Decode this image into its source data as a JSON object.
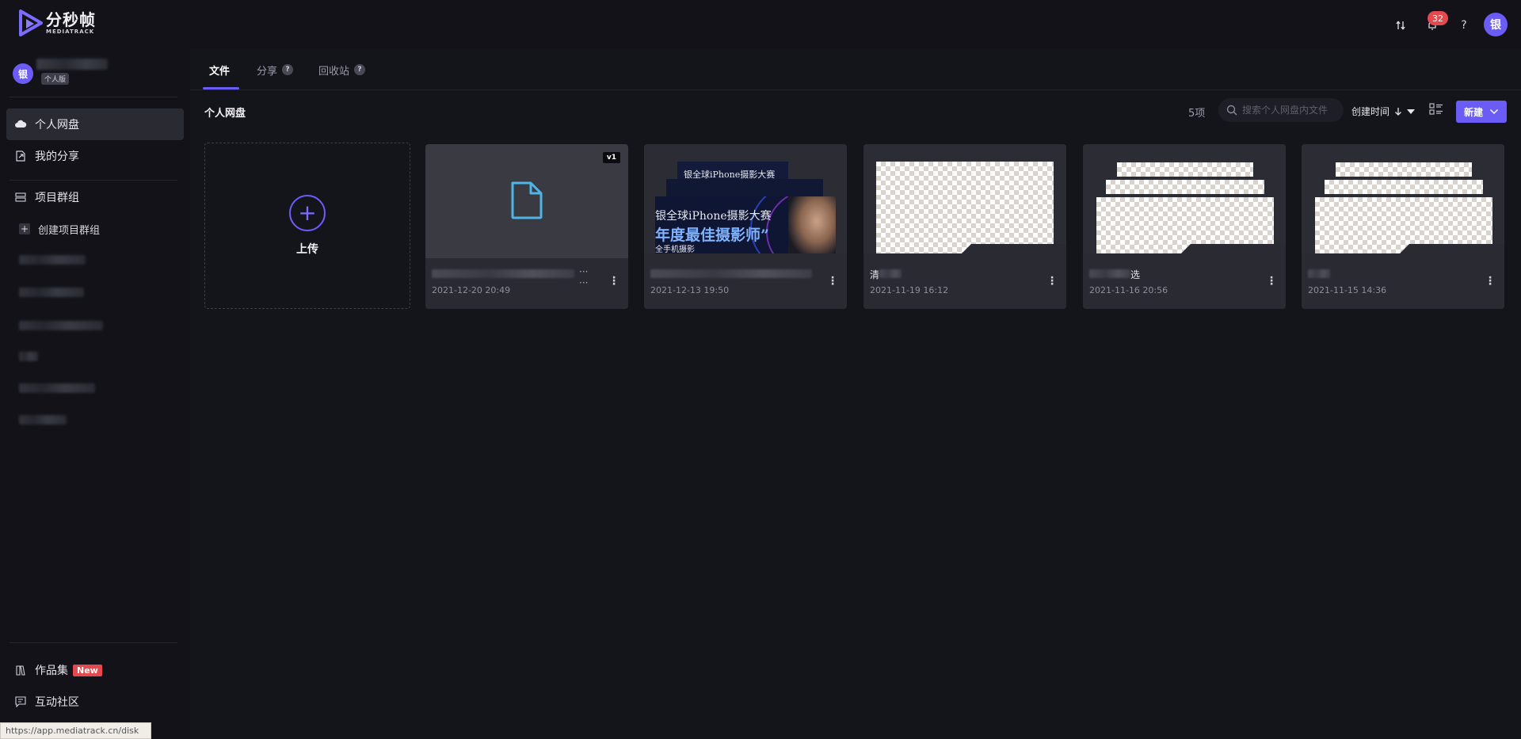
{
  "app": {
    "logo_cn": "分秒帧",
    "logo_en": "MEDIATRACK"
  },
  "header": {
    "notification_count": "32",
    "help_label": "?",
    "avatar_initial": "银"
  },
  "sidebar": {
    "user_initial": "银",
    "plan_badge": "个人版",
    "nav": [
      {
        "label": "个人网盘",
        "icon": "cloud-icon",
        "active": true
      },
      {
        "label": "我的分享",
        "icon": "share-icon",
        "active": false
      },
      {
        "label": "项目群组",
        "icon": "group-icon",
        "active": false
      }
    ],
    "create_group_label": "创建项目群组",
    "bottom_nav": [
      {
        "label": "作品集",
        "icon": "portfolio-icon",
        "badge": "New"
      },
      {
        "label": "互动社区",
        "icon": "community-icon"
      }
    ],
    "status_url": "https://app.mediatrack.cn/disk"
  },
  "tabs": [
    {
      "label": "文件",
      "active": true,
      "help": false
    },
    {
      "label": "分享",
      "active": false,
      "help": true
    },
    {
      "label": "回收站",
      "active": false,
      "help": true
    }
  ],
  "help_mark": "?",
  "toolbar": {
    "breadcrumb": "个人网盘",
    "item_count": "5项",
    "search_placeholder": "搜索个人网盘内文件",
    "sort_label": "创建时间",
    "new_button": "新建"
  },
  "upload": {
    "label": "上传"
  },
  "files": [
    {
      "version": "v1",
      "date": "2021-12-20 20:49",
      "thumb": "document"
    },
    {
      "date": "2021-12-13 19:50",
      "thumb": "poster-stack",
      "poster_lines": [
        "银全球iPhone摄影大赛",
        "年度最佳摄影师”",
        "全手机摄影"
      ]
    },
    {
      "name_prefix": "清",
      "date": "2021-11-19 16:12",
      "thumb": "transparent"
    },
    {
      "name_suffix": "选",
      "date": "2021-11-16 20:56",
      "thumb": "transparent-stack"
    },
    {
      "date": "2021-11-15 14:36",
      "thumb": "transparent-stack"
    }
  ],
  "colors": {
    "accent": "#6b5cf6",
    "badge_red": "#e5484d",
    "doc_icon": "#4fb4e6"
  }
}
